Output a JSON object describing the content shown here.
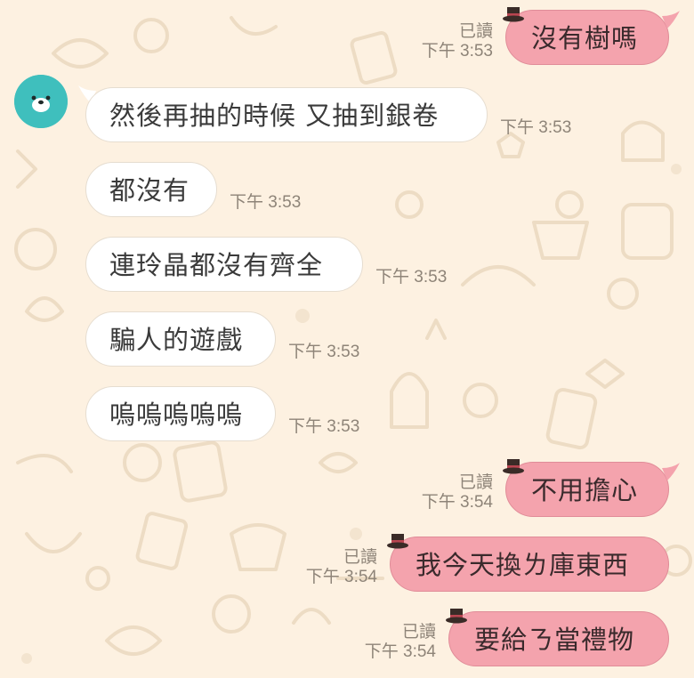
{
  "conversation": {
    "accent_out": "#f4a3ad",
    "accent_in": "#ffffff",
    "avatar_icon": "bear-face-icon",
    "sent_badge_icon": "top-hat-icon",
    "messages": [
      {
        "dir": "out",
        "text": "沒有樹嗎",
        "read": "已讀",
        "time": "下午 3:53"
      },
      {
        "dir": "in",
        "text": "然後再抽的時候 又抽到銀卷",
        "time": "下午 3:53"
      },
      {
        "dir": "in",
        "text": "都沒有",
        "time": "下午 3:53"
      },
      {
        "dir": "in",
        "text": "連玲晶都沒有齊全",
        "time": "下午 3:53"
      },
      {
        "dir": "in",
        "text": "騙人的遊戲",
        "time": "下午 3:53"
      },
      {
        "dir": "in",
        "text": "嗚嗚嗚嗚嗚",
        "time": "下午 3:53"
      },
      {
        "dir": "out",
        "text": "不用擔心",
        "read": "已讀",
        "time": "下午 3:54"
      },
      {
        "dir": "out",
        "text": "我今天換ㄌ庫東西",
        "read": "已讀",
        "time": "下午 3:54"
      },
      {
        "dir": "out",
        "text": "要給ㄋ當禮物",
        "read": "已讀",
        "time": "下午 3:54"
      }
    ]
  }
}
